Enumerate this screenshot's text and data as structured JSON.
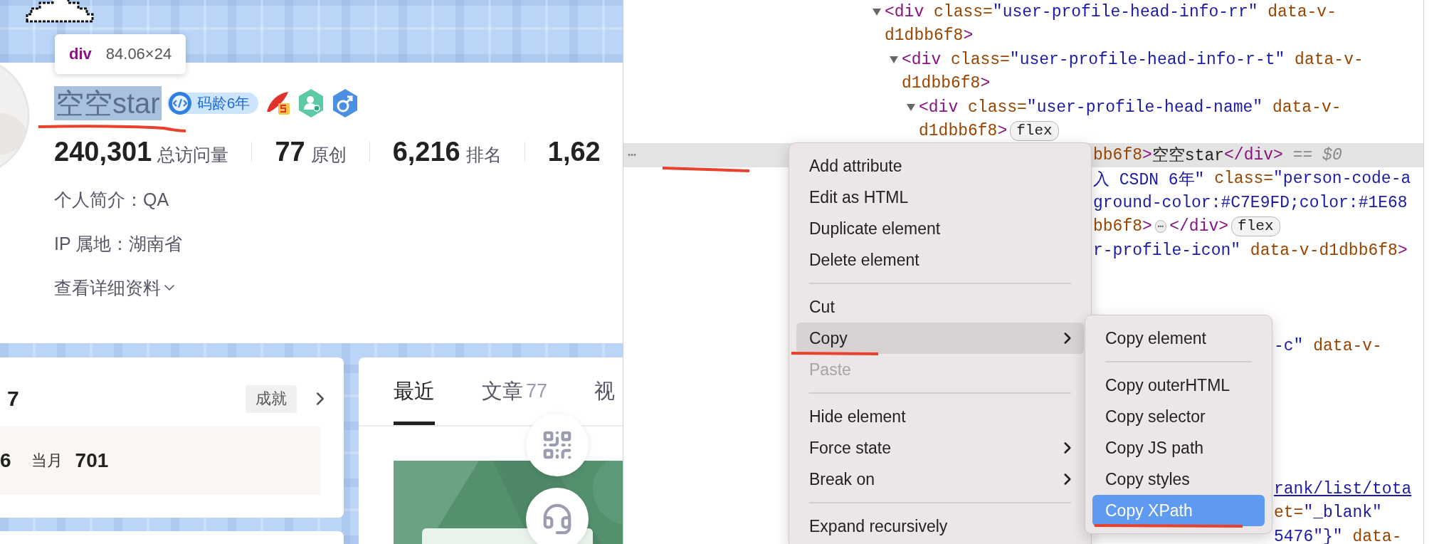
{
  "profile_page": {
    "tooltip": {
      "tag": "div",
      "size": "84.06×24"
    },
    "name": {
      "text": "空空star",
      "highlighted": true,
      "underlined": true
    },
    "badge": "码龄6年",
    "stats": [
      {
        "value": "240,301",
        "label": "总访问量"
      },
      {
        "value": "77",
        "label": "原创"
      },
      {
        "value": "6,216",
        "label": "排名"
      },
      {
        "value": "1,62"
      }
    ],
    "intro": "个人简介：QA",
    "location": "IP 属地：湖南省",
    "details_link": "查看详细资料",
    "achievement_card": {
      "count": "7",
      "button": "成就",
      "totals": [
        {
          "value": "6"
        },
        {
          "label": "当月",
          "value": "701"
        }
      ]
    },
    "tabs": [
      {
        "label": "最近",
        "selected": true
      },
      {
        "label": "文章",
        "count": "77",
        "selected": false
      },
      {
        "label": "视",
        "selected": false
      }
    ]
  },
  "devtools": {
    "tree": [
      {
        "expanded": true,
        "tokens": [
          {
            "kind": "tag",
            "text": "<div"
          },
          {
            "kind": "attr",
            "text": " class="
          },
          {
            "kind": "value",
            "text": "\"user-profile-head-info-rr\""
          },
          {
            "kind": "attr",
            "text": " data-v-"
          }
        ],
        "continuation": [
          {
            "kind": "attr",
            "text": "d1dbb6f8"
          },
          {
            "kind": "tag",
            "text": ">"
          }
        ],
        "children": [
          {
            "expanded": true,
            "tokens": [
              {
                "kind": "tag",
                "text": "<div"
              },
              {
                "kind": "attr",
                "text": " class="
              },
              {
                "kind": "value",
                "text": "\"user-profile-head-info-r-t\""
              },
              {
                "kind": "attr",
                "text": " data-v-"
              }
            ],
            "continuation": [
              {
                "kind": "attr",
                "text": "d1dbb6f8"
              },
              {
                "kind": "tag",
                "text": ">"
              }
            ],
            "children": [
              {
                "expanded": true,
                "tokens": [
                  {
                    "kind": "tag",
                    "text": "<div"
                  },
                  {
                    "kind": "attr",
                    "text": " class="
                  },
                  {
                    "kind": "value",
                    "text": "\"user-profile-head-name\""
                  },
                  {
                    "kind": "attr",
                    "text": " data-v-"
                  }
                ],
                "continuation": [
                  {
                    "kind": "attr",
                    "text": "d1dbb6f8"
                  },
                  {
                    "kind": "tag",
                    "text": ">"
                  },
                  {
                    "kind": "badge",
                    "text": "flex"
                  }
                ],
                "children": [
                  {
                    "selected": true,
                    "underlined": true,
                    "gutter": "⋯",
                    "tokens": [
                      {
                        "kind": "attr",
                        "text": "bb6f8"
                      },
                      {
                        "kind": "tag",
                        "text": ">"
                      },
                      {
                        "kind": "text",
                        "text": "空空star"
                      },
                      {
                        "kind": "tag",
                        "text": "</div>"
                      },
                      {
                        "kind": "dim",
                        "text": " == $0"
                      }
                    ]
                  }
                ]
              }
            ]
          }
        ]
      }
    ],
    "rows_beside_menu": [
      {
        "tokens": [
          {
            "kind": "value",
            "text": "入 CSDN 6年\""
          },
          {
            "kind": "attr",
            "text": " class="
          },
          {
            "kind": "value",
            "text": "\"person-code-a"
          }
        ]
      },
      {
        "tokens": [
          {
            "kind": "value",
            "text": "ground-color:#C7E9FD;color:#1E68"
          }
        ]
      },
      {
        "tokens": [
          {
            "kind": "attr",
            "text": "bb6f8"
          },
          {
            "kind": "tag",
            "text": ">"
          },
          {
            "kind": "ellipsis",
            "text": "⋯"
          },
          {
            "kind": "tag",
            "text": "</div>"
          },
          {
            "kind": "badge",
            "text": "flex"
          }
        ]
      },
      {
        "tokens": [
          {
            "kind": "value",
            "text": "r-profile-icon\""
          },
          {
            "kind": "attr",
            "text": " data-v-d1dbb6f8"
          },
          {
            "kind": "tag",
            "text": ">"
          }
        ]
      }
    ],
    "rows_beside_submenu": [
      {
        "tokens": [
          {
            "kind": "value",
            "text": "-c\""
          },
          {
            "kind": "attr",
            "text": " data-v-"
          }
        ]
      },
      {
        "tokens": [
          {
            "kind": "link",
            "text": "rank/list/tota"
          }
        ]
      },
      {
        "tokens": [
          {
            "kind": "attr",
            "text": "et="
          },
          {
            "kind": "value",
            "text": "\"_blank\""
          }
        ]
      },
      {
        "tokens": [
          {
            "kind": "value",
            "text": "5476\"}\""
          },
          {
            "kind": "attr",
            "text": " data-"
          }
        ]
      }
    ],
    "context_menu": {
      "items": [
        {
          "kind": "item",
          "label": "Add attribute",
          "selected": false,
          "disabled": false,
          "underlined": false
        },
        {
          "kind": "item",
          "label": "Edit as HTML",
          "selected": false,
          "disabled": false,
          "underlined": false
        },
        {
          "kind": "item",
          "label": "Duplicate element",
          "selected": false,
          "disabled": false,
          "underlined": false
        },
        {
          "kind": "item",
          "label": "Delete element",
          "selected": false,
          "disabled": false,
          "underlined": false
        },
        {
          "kind": "separator"
        },
        {
          "kind": "item",
          "label": "Cut",
          "selected": false,
          "disabled": false,
          "underlined": false
        },
        {
          "kind": "submenu",
          "label": "Copy",
          "selected": true,
          "disabled": false,
          "underlined": true
        },
        {
          "kind": "item",
          "label": "Paste",
          "selected": false,
          "disabled": true,
          "underlined": false
        },
        {
          "kind": "separator"
        },
        {
          "kind": "item",
          "label": "Hide element",
          "selected": false,
          "disabled": false,
          "underlined": false
        },
        {
          "kind": "submenu",
          "label": "Force state",
          "selected": false,
          "disabled": false,
          "underlined": false
        },
        {
          "kind": "submenu",
          "label": "Break on",
          "selected": false,
          "disabled": false,
          "underlined": false
        },
        {
          "kind": "separator"
        },
        {
          "kind": "item",
          "label": "Expand recursively",
          "selected": false,
          "disabled": false,
          "underlined": false
        }
      ]
    },
    "submenu": {
      "items": [
        {
          "kind": "item",
          "label": "Copy element",
          "selected": false,
          "disabled": false,
          "underlined": false
        },
        {
          "kind": "separator"
        },
        {
          "kind": "item",
          "label": "Copy outerHTML",
          "selected": false,
          "disabled": false,
          "underlined": false
        },
        {
          "kind": "item",
          "label": "Copy selector",
          "selected": false,
          "disabled": false,
          "underlined": false
        },
        {
          "kind": "item",
          "label": "Copy JS path",
          "selected": false,
          "disabled": false,
          "underlined": false
        },
        {
          "kind": "item",
          "label": "Copy styles",
          "selected": false,
          "disabled": false,
          "underlined": false
        },
        {
          "kind": "item",
          "label": "Copy XPath",
          "selected": true,
          "disabled": false,
          "underlined": true
        }
      ]
    }
  }
}
